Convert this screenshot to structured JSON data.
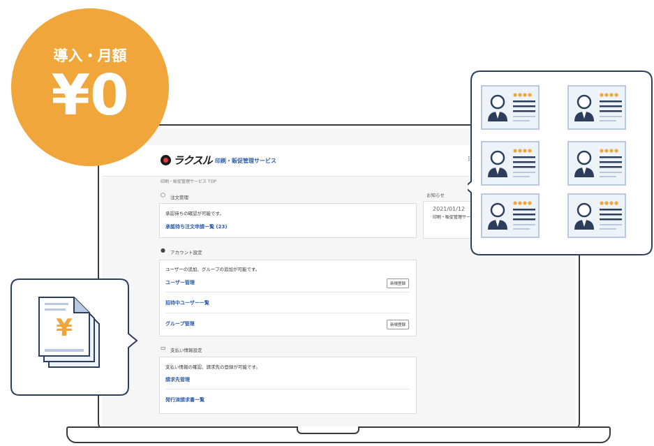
{
  "badge": {
    "top": "導入・月額",
    "price": "¥0"
  },
  "app": {
    "logo": "ラクスル",
    "service_name": "印刷・販促管理サービス",
    "grid_icon": "grid-icon",
    "breadcrumb": "印刷・販促管理サービス TOP"
  },
  "orders": {
    "title": "注文管理",
    "description": "承認待ちの確認が可能です。",
    "link": "承認待ち注文申請一覧 (23)"
  },
  "account": {
    "title": "アカウント設定",
    "description": "ユーザーの追加、グループの追加が可能です。",
    "items": [
      {
        "label": "ユーザー管理",
        "button": "新規登録"
      },
      {
        "label": "招待中ユーザー一覧"
      },
      {
        "label": "グループ管理",
        "button": "新規登録"
      }
    ]
  },
  "payment": {
    "title": "支払い情報設定",
    "description": "支払い情報の確認、請求先の登録が可能です。",
    "items": [
      {
        "label": "請求先管理"
      },
      {
        "label": "発行済請求書一覧"
      }
    ]
  },
  "news": {
    "title": "お知らせ",
    "date": "2021/01/12",
    "text": "印刷・販促管理サー ました。"
  },
  "invoice_bubble": {
    "symbol": "¥"
  },
  "colors": {
    "accent": "#f0a63a",
    "link": "#2a5ba8",
    "outline": "#2c3e5b",
    "card_bg": "#eef3fa"
  }
}
